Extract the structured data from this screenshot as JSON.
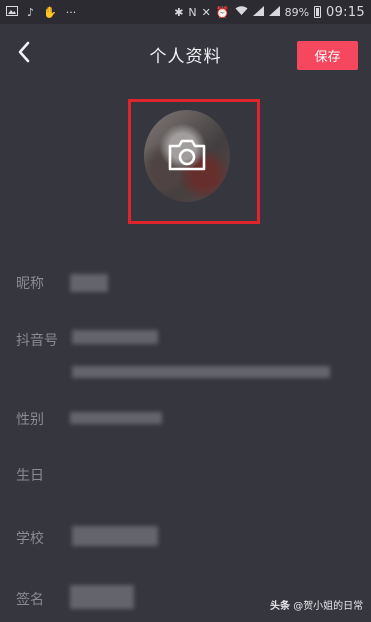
{
  "status_bar": {
    "battery": "89%",
    "time": "09:15",
    "overflow": "···"
  },
  "header": {
    "title": "个人资料",
    "save_label": "保存"
  },
  "fields": {
    "nickname": "昵称",
    "douyin_id": "抖音号",
    "gender": "性别",
    "birthday": "生日",
    "school": "学校",
    "signature": "签名"
  },
  "watermark": {
    "source": "头条",
    "author": "@贺小姐的日常"
  },
  "colors": {
    "background": "#36363f",
    "accent": "#f5485f",
    "highlight_frame": "#e0242c"
  },
  "icons": {
    "back": "chevron-left-icon",
    "avatar_overlay": "camera-icon"
  }
}
